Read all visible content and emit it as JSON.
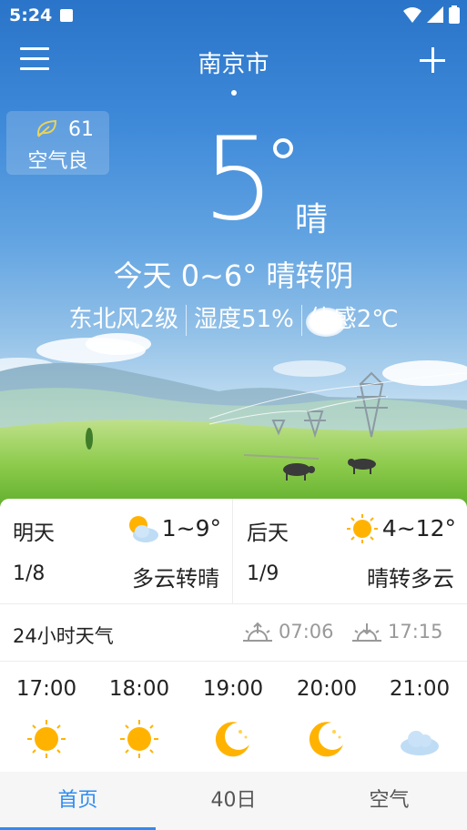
{
  "status_bar": {
    "time": "5:24"
  },
  "header": {
    "city": "南京市"
  },
  "aqi": {
    "value": "61",
    "level": "空气良"
  },
  "current": {
    "temperature": "5",
    "condition": "晴",
    "today_summary": "今天 0~6° 晴转阴",
    "wind": "东北风2级",
    "humidity": "湿度51%",
    "feels_like": "体感2℃"
  },
  "forecast": [
    {
      "label": "明天",
      "range": "1~9°",
      "date": "1/8",
      "description": "多云转晴",
      "icon": "partly-cloudy-icon"
    },
    {
      "label": "后天",
      "range": "4~12°",
      "date": "1/9",
      "description": "晴转多云",
      "icon": "sun-icon"
    }
  ],
  "hourly_section": {
    "title": "24小时天气",
    "sunrise": "07:06",
    "sunset": "17:15"
  },
  "hourly": [
    {
      "time": "17:00",
      "icon": "sun-icon"
    },
    {
      "time": "18:00",
      "icon": "sun-icon"
    },
    {
      "time": "19:00",
      "icon": "moon-icon"
    },
    {
      "time": "20:00",
      "icon": "moon-icon"
    },
    {
      "time": "21:00",
      "icon": "cloud-icon"
    }
  ],
  "bottom_nav": {
    "home": "首页",
    "forty_day": "40日",
    "air": "空气"
  },
  "colors": {
    "accent": "#2f8cf0",
    "sun": "#ffb300"
  }
}
